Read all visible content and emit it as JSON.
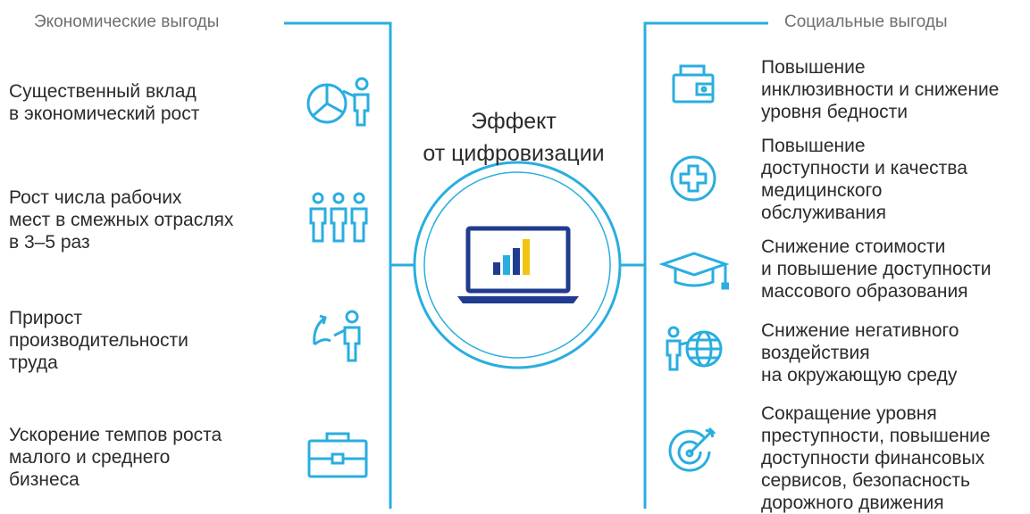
{
  "headers": {
    "left": "Экономические выгоды",
    "right": "Социальные выгоды"
  },
  "center": {
    "title_lines": [
      "Эффект",
      "от цифровизации"
    ]
  },
  "left_items": [
    {
      "icon": "pie-chart-person-icon",
      "lines": [
        "Существенный вклад",
        "в экономический рост"
      ]
    },
    {
      "icon": "people-group-icon",
      "lines": [
        "Рост числа рабочих",
        "мест в смежных отраслях",
        "в 3–5 раз"
      ]
    },
    {
      "icon": "growth-arrow-person-icon",
      "lines": [
        "Прирост",
        "производительности",
        "труда"
      ]
    },
    {
      "icon": "briefcase-icon",
      "lines": [
        "Ускорение темпов роста",
        "малого и среднего",
        "бизнеса"
      ]
    }
  ],
  "right_items": [
    {
      "icon": "wallet-icon",
      "lines": [
        "Повышение",
        "инклюзивности и снижение",
        "уровня бедности"
      ]
    },
    {
      "icon": "medical-cross-icon",
      "lines": [
        "Повышение",
        "доступности и качества",
        "медицинского",
        "обслуживания"
      ]
    },
    {
      "icon": "graduation-cap-icon",
      "lines": [
        "Снижение стоимости",
        "и повышение доступности",
        "массового образования"
      ]
    },
    {
      "icon": "person-globe-icon",
      "lines": [
        "Снижение негативного",
        "воздействия",
        "на окружающую среду"
      ]
    },
    {
      "icon": "target-arrow-icon",
      "lines": [
        "Сокращение уровня",
        "преступности, повышение",
        "доступности финансовых",
        "сервисов, безопасность",
        "дорожного движения"
      ]
    }
  ],
  "colors": {
    "accent": "#29aee0",
    "text": "#2b2b2b",
    "header_text": "#6f6f6f",
    "chart_navy": "#1f3c8e",
    "chart_yellow": "#f2c40f"
  }
}
